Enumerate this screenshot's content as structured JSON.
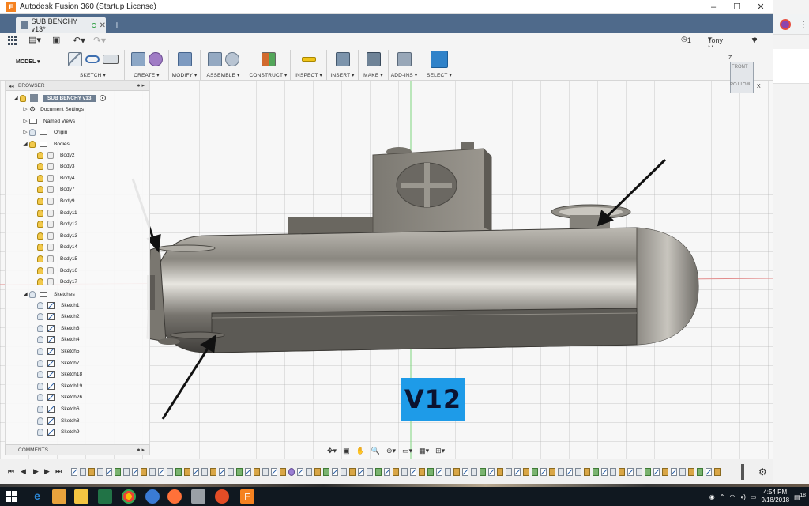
{
  "window": {
    "title": "Autodesk Fusion 360 (Startup License)",
    "controls": [
      "–",
      "☐",
      "✕"
    ]
  },
  "tab": {
    "label": "SUB BENCHY v13*",
    "add": "+"
  },
  "quick_access": {
    "job_count": "1",
    "user": "Tony Nunez",
    "help": "?"
  },
  "toolbar": {
    "mode": "MODEL ▾",
    "groups": [
      "SKETCH ▾",
      "CREATE ▾",
      "MODIFY ▾",
      "ASSEMBLE ▾",
      "CONSTRUCT ▾",
      "INSPECT ▾",
      "INSERT ▾",
      "MAKE ▾",
      "ADD-INS ▾",
      "SELECT ▾"
    ]
  },
  "viewcube": {
    "front": "FRONT",
    "bottom": "BOTTOM",
    "z": "Z",
    "x": "X"
  },
  "browser": {
    "title": "BROWSER",
    "root": "SUB BENCHY v13",
    "document_settings": "Document Settings",
    "named_views": "Named Views",
    "origin": "Origin",
    "bodies_label": "Bodies",
    "bodies": [
      "Body2",
      "Body3",
      "Body4",
      "Body7",
      "Body9",
      "Body11",
      "Body12",
      "Body13",
      "Body14",
      "Body15",
      "Body16",
      "Body17"
    ],
    "sketches_label": "Sketches",
    "sketches": [
      "Sketch1",
      "Sketch2",
      "Sketch3",
      "Sketch4",
      "Sketch5",
      "Sketch7",
      "Sketch18",
      "Sketch19",
      "Sketch26",
      "Sketch6",
      "Sketch8",
      "Sketch9"
    ]
  },
  "comments": {
    "title": "COMMENTS"
  },
  "overlay_label": "V12",
  "taskbar": {
    "time": "4:54 PM",
    "date": "9/18/2018",
    "notifications": "18"
  },
  "colors": {
    "tabbar": "#4f6a8b",
    "select_blue": "#2f82c9",
    "label_bg": "#1e9be8",
    "hull": "#8a8780"
  }
}
